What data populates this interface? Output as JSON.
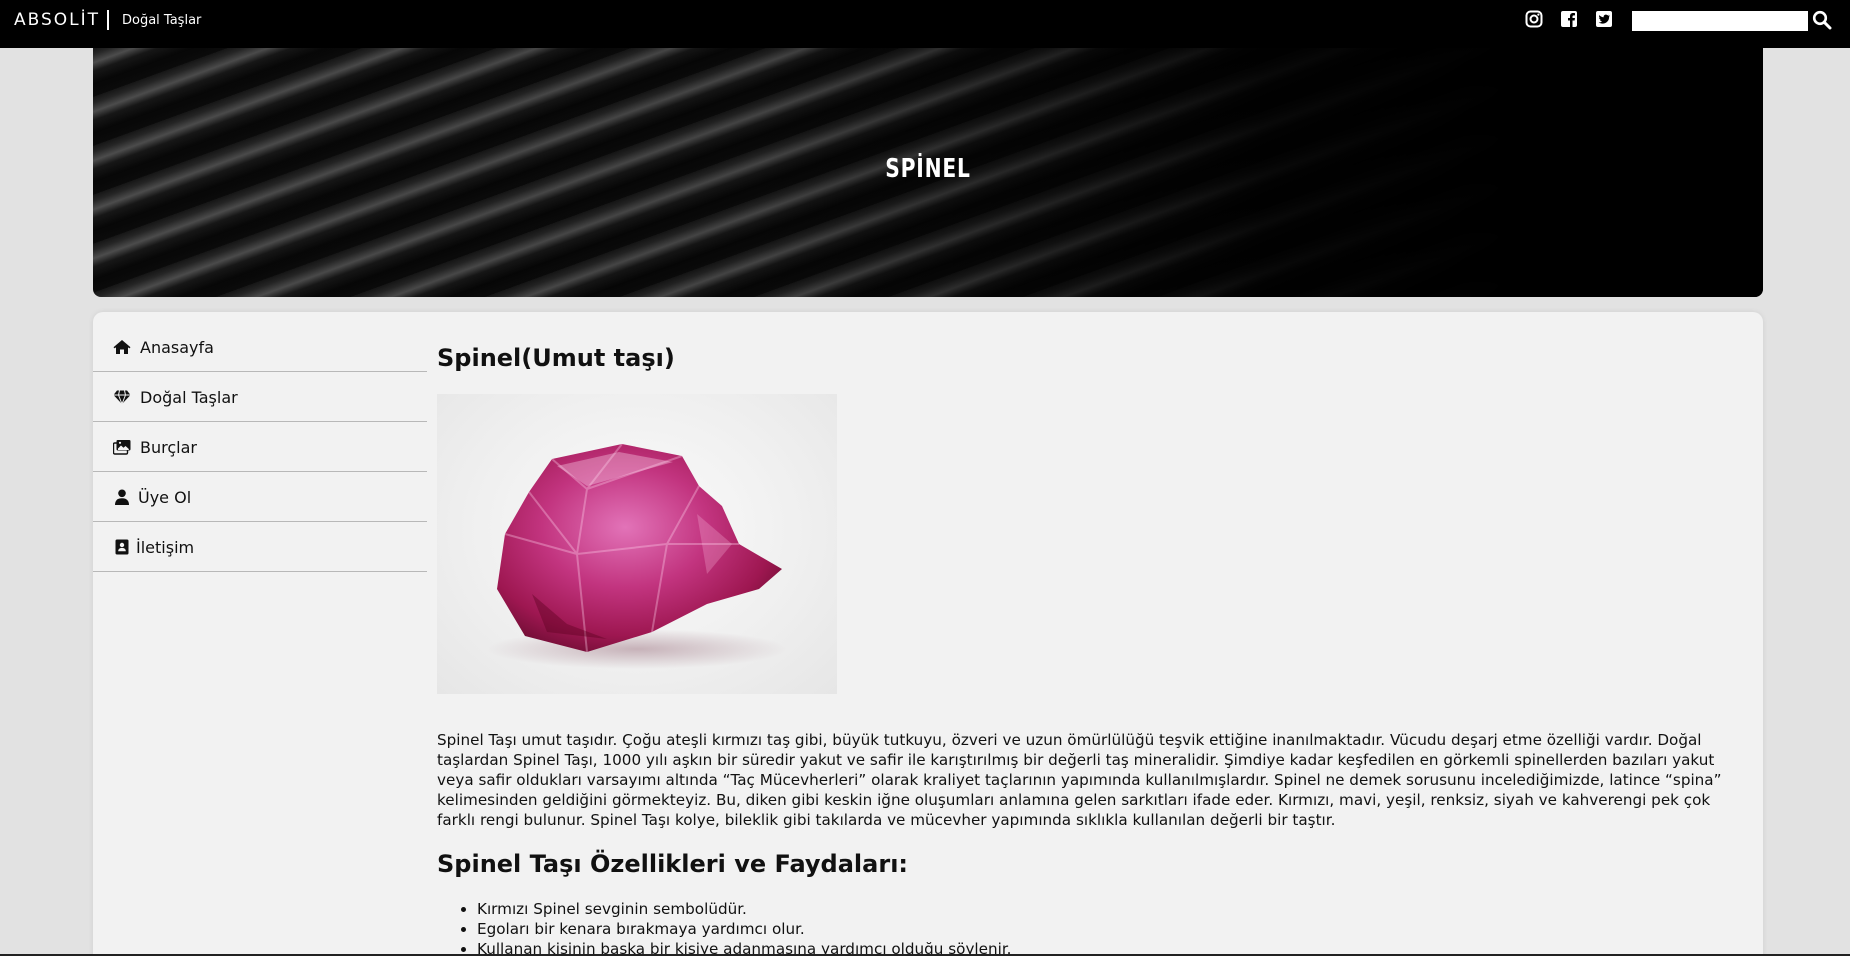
{
  "header": {
    "brand": "ABSOLİT",
    "subtitle": "Doğal Taşlar",
    "social": [
      "instagram-icon",
      "facebook-icon",
      "twitter-icon"
    ],
    "search_placeholder": "",
    "search_icon": "search-icon"
  },
  "banner": {
    "title": "SPİNEL"
  },
  "sidebar": {
    "items": [
      {
        "label": "Anasayfa",
        "icon": "home-icon"
      },
      {
        "label": "Doğal Taşlar",
        "icon": "gem-icon"
      },
      {
        "label": "Burçlar",
        "icon": "images-icon"
      },
      {
        "label": "Üye Ol",
        "icon": "user-icon"
      },
      {
        "label": "İletişim",
        "icon": "contact-book-icon"
      }
    ]
  },
  "main": {
    "title": "Spinel(Umut taşı)",
    "image_alt": "spinel-stone-image",
    "intro": "Spinel Taşı umut taşıdır. Çoğu ateşli kırmızı taş gibi, büyük tutkuyu, özveri ve uzun ömürlülüğü teşvik ettiğine inanılmaktadır. Vücudu deşarj etme özelliği vardır. Doğal taşlardan Spinel Taşı, 1000 yılı aşkın bir süredir yakut ve safir ile karıştırılmış bir değerli taş mineralidir. Şimdiye kadar keşfedilen en görkemli spinellerden bazıları yakut veya safir oldukları varsayımı altında “Taç Mücevherleri” olarak kraliyet taçlarının yapımında kullanılmışlardır. Spinel ne demek sorusunu incelediğimizde, latince “spina” kelimesinden geldiğini görmekteyiz. Bu, diken gibi keskin iğne oluşumları anlamına gelen sarkıtları ifade eder. Kırmızı, mavi, yeşil, renksiz, siyah ve kahverengi pek çok farklı rengi bulunur. Spinel Taşı kolye, bileklik gibi takılarda ve mücevher yapımında sıklıkla kullanılan değerli bir taştır.",
    "features_title": "Spinel Taşı Özellikleri ve Faydaları:",
    "features": [
      "Kırmızı Spinel sevginin sembolüdür.",
      "Egoları bir kenara bırakmaya yardımcı olur.",
      "Kullanan kişinin başka bir kişiye adanmasına yardımcı olduğu söylenir."
    ]
  }
}
